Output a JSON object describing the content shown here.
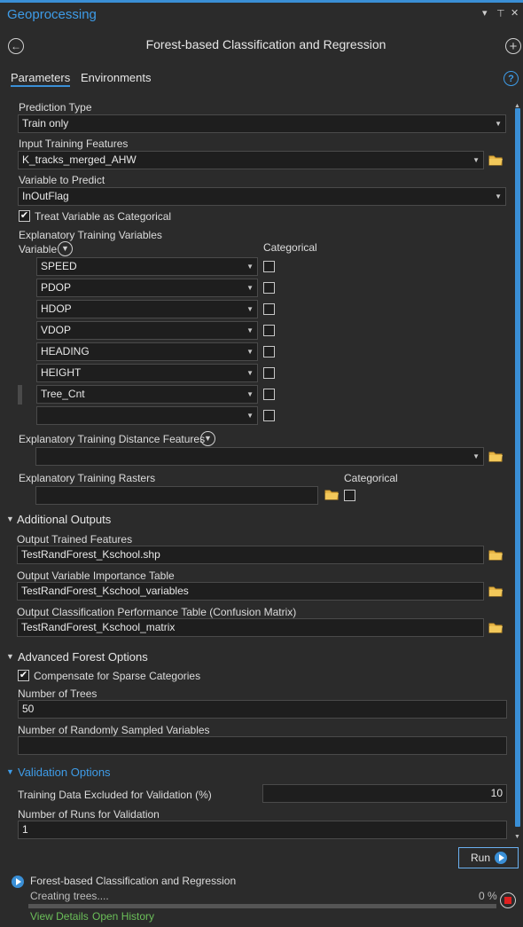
{
  "pane": {
    "title": "Geoprocessing",
    "menu_glyph": "▾",
    "pin_glyph": "⊥",
    "close_glyph": "✕"
  },
  "header": {
    "back_glyph": "←",
    "tool_title": "Forest-based Classification and Regression",
    "add_glyph": "+"
  },
  "tabs": [
    {
      "label": "Parameters",
      "active": true
    },
    {
      "label": "Environments",
      "active": false
    }
  ],
  "help_glyph": "?",
  "params": {
    "prediction_type": {
      "label": "Prediction Type",
      "value": "Train only"
    },
    "input_training_features": {
      "label": "Input Training Features",
      "value": "K_tracks_merged_AHW"
    },
    "variable_to_predict": {
      "label": "Variable to Predict",
      "value": "InOutFlag"
    },
    "treat_categorical": {
      "label": "Treat Variable as Categorical",
      "checked": true
    },
    "explanatory_vars": {
      "label": "Explanatory Training Variables",
      "col_variable": "Variable",
      "col_categorical": "Categorical",
      "rows": [
        "SPEED",
        "PDOP",
        "HDOP",
        "VDOP",
        "HEADING",
        "HEIGHT",
        "Tree_Cnt",
        ""
      ]
    },
    "distance_features": {
      "label": "Explanatory Training Distance Features",
      "value": ""
    },
    "rasters": {
      "label": "Explanatory Training Rasters",
      "col_categorical": "Categorical",
      "value": ""
    }
  },
  "additional_outputs": {
    "title": "Additional Outputs",
    "trained_features": {
      "label": "Output Trained Features",
      "value": "TestRandForest_Kschool.shp"
    },
    "variable_importance": {
      "label": "Output Variable Importance Table",
      "value": "TestRandForest_Kschool_variables"
    },
    "confusion_matrix": {
      "label": "Output Classification Performance Table (Confusion Matrix)",
      "value": "TestRandForest_Kschool_matrix"
    }
  },
  "advanced_forest": {
    "title": "Advanced Forest Options",
    "compensate_sparse": {
      "label": "Compensate for Sparse Categories",
      "checked": true
    },
    "num_trees": {
      "label": "Number of Trees",
      "value": "50"
    },
    "num_sampled_vars": {
      "label": "Number of Randomly Sampled Variables",
      "value": ""
    }
  },
  "validation": {
    "title": "Validation Options",
    "excluded": {
      "label": "Training Data Excluded for Validation (%)",
      "value": "10"
    },
    "num_runs": {
      "label": "Number of Runs for Validation",
      "value": "1"
    }
  },
  "run_button": {
    "label": "Run"
  },
  "status": {
    "tool_name": "Forest-based Classification and Regression",
    "message": "Creating trees....",
    "percent_text": "0 %",
    "progress": 0,
    "view_details": "View Details",
    "open_history": "Open History"
  },
  "colors": {
    "accent": "#3a8fd6",
    "link_green": "#6bbf59",
    "stop_red": "#e02020",
    "background": "#2b2b2b",
    "field_bg": "#1e1e1e"
  }
}
